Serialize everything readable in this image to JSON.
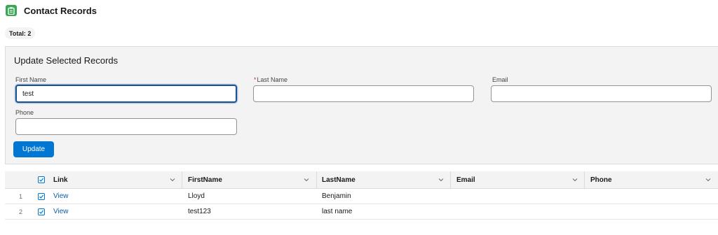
{
  "header": {
    "title": "Contact Records",
    "icon": "contact-list-icon"
  },
  "total_badge": "Total: 2",
  "form": {
    "title": "Update Selected Records",
    "first_name": {
      "label": "First Name",
      "value": "test"
    },
    "last_name": {
      "required_mark": "*",
      "label": "Last Name",
      "value": ""
    },
    "email": {
      "label": "Email",
      "value": ""
    },
    "phone": {
      "label": "Phone",
      "value": ""
    },
    "update_label": "Update"
  },
  "table": {
    "columns": [
      "Link",
      "FirstName",
      "LastName",
      "Email",
      "Phone"
    ],
    "rows": [
      {
        "num": "1",
        "selected": true,
        "link": "View",
        "first": "Lloyd",
        "last": "Benjamin",
        "email": "",
        "phone": ""
      },
      {
        "num": "2",
        "selected": true,
        "link": "View",
        "first": "test123",
        "last": "last name",
        "email": "",
        "phone": ""
      }
    ]
  },
  "colors": {
    "brand_blue": "#0176d3",
    "icon_green": "#3ba755",
    "link": "#0b5cab"
  }
}
